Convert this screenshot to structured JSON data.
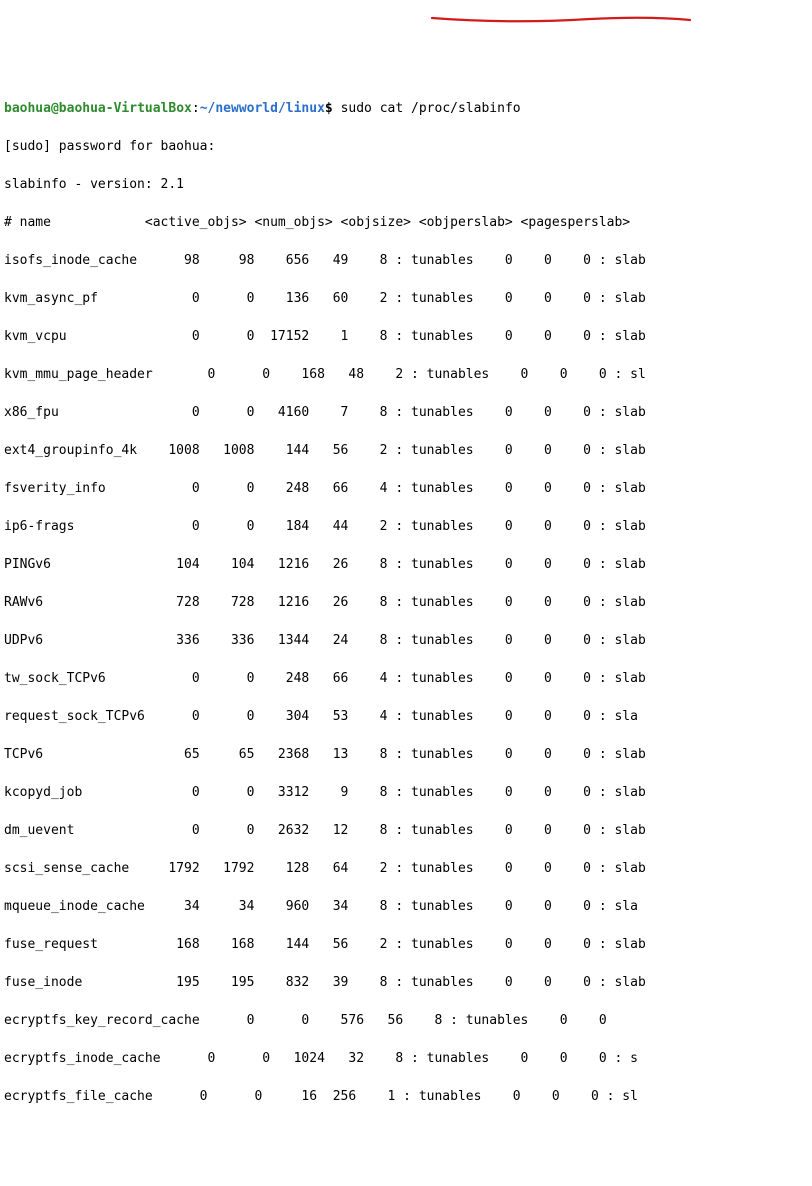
{
  "prompt": {
    "user": "baohua",
    "at": "@",
    "host": "baohua-VirtualBox",
    "colon": ":",
    "path": "~/newworld/linux",
    "dollar": "$ ",
    "command": "sudo cat /proc/slabinfo"
  },
  "sudo_line": "[sudo] password for baohua:",
  "version_line": "slabinfo - version: 2.1",
  "header": "# name            <active_objs> <num_objs> <objsize> <objperslab> <pagesperslab>",
  "rows": [
    "isofs_inode_cache      98     98    656   49    8 : tunables    0    0    0 : slab",
    "kvm_async_pf            0      0    136   60    2 : tunables    0    0    0 : slab",
    "kvm_vcpu                0      0  17152    1    8 : tunables    0    0    0 : slab",
    "kvm_mmu_page_header       0      0    168   48    2 : tunables    0    0    0 : sl",
    "x86_fpu                 0      0   4160    7    8 : tunables    0    0    0 : slab",
    "ext4_groupinfo_4k    1008   1008    144   56    2 : tunables    0    0    0 : slab",
    "fsverity_info           0      0    248   66    4 : tunables    0    0    0 : slab",
    "ip6-frags               0      0    184   44    2 : tunables    0    0    0 : slab",
    "PINGv6                104    104   1216   26    8 : tunables    0    0    0 : slab",
    "RAWv6                 728    728   1216   26    8 : tunables    0    0    0 : slab",
    "UDPv6                 336    336   1344   24    8 : tunables    0    0    0 : slab",
    "tw_sock_TCPv6           0      0    248   66    4 : tunables    0    0    0 : slab",
    "request_sock_TCPv6      0      0    304   53    4 : tunables    0    0    0 : sla",
    "TCPv6                  65     65   2368   13    8 : tunables    0    0    0 : slab",
    "kcopyd_job              0      0   3312    9    8 : tunables    0    0    0 : slab",
    "dm_uevent               0      0   2632   12    8 : tunables    0    0    0 : slab",
    "scsi_sense_cache     1792   1792    128   64    2 : tunables    0    0    0 : slab",
    "mqueue_inode_cache     34     34    960   34    8 : tunables    0    0    0 : sla",
    "fuse_request          168    168    144   56    2 : tunables    0    0    0 : slab",
    "fuse_inode            195    195    832   39    8 : tunables    0    0    0 : slab",
    "ecryptfs_key_record_cache      0      0    576   56    8 : tunables    0    0   ",
    "ecryptfs_inode_cache      0      0   1024   32    8 : tunables    0    0    0 : s",
    "ecryptfs_file_cache      0      0     16  256    1 : tunables    0    0    0 : sl"
  ]
}
